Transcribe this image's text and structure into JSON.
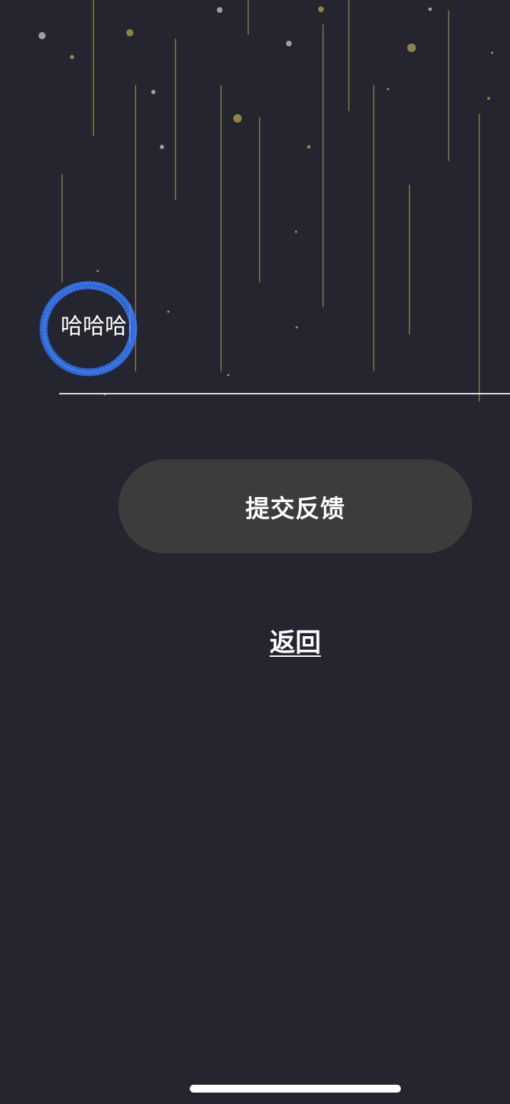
{
  "feedback_input": {
    "value": "哈哈哈"
  },
  "actions": {
    "submit_label": "提交反馈",
    "back_label": "返回"
  },
  "colors": {
    "background": "#24252e",
    "button_background": "#3c3c3c",
    "text": "#ffffff",
    "meteor_streak": "#8a7f3f",
    "annotation_circle": "#2f6fe8"
  }
}
